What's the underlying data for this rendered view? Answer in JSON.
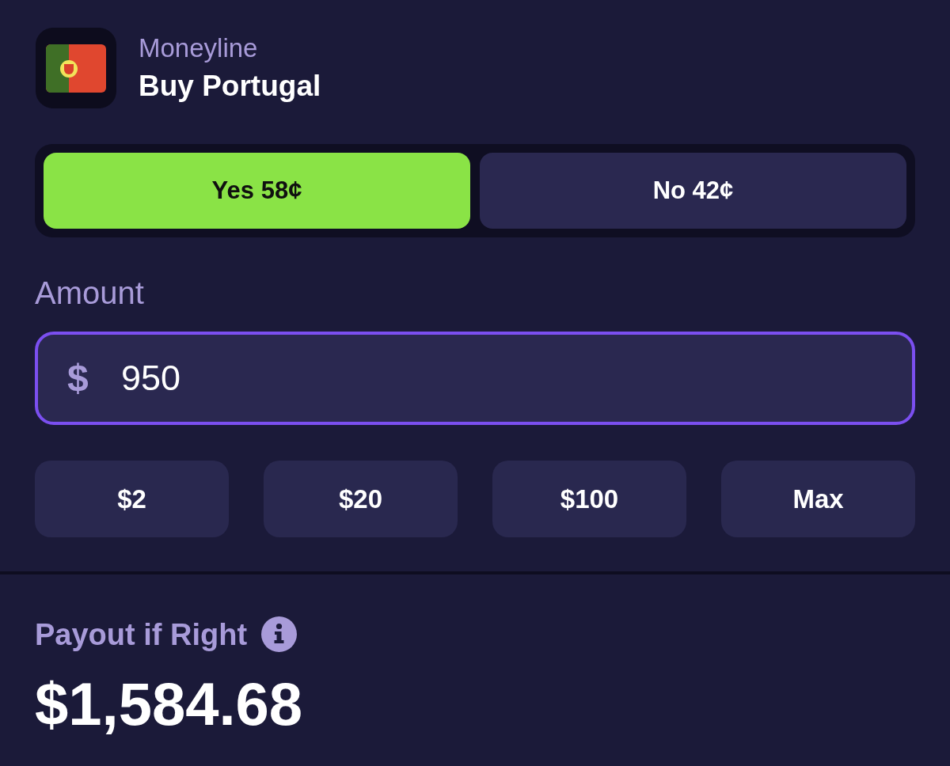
{
  "market": {
    "type_label": "Moneyline",
    "title": "Buy Portugal"
  },
  "outcomes": [
    {
      "label": "Yes 58¢",
      "selected": true
    },
    {
      "label": "No 42¢",
      "selected": false
    }
  ],
  "amount": {
    "label": "Amount",
    "currency_symbol": "$",
    "value": "950",
    "focused": true
  },
  "quick_amounts": [
    "$2",
    "$20",
    "$100",
    "Max"
  ],
  "payout": {
    "label": "Payout if Right",
    "value": "$1,584.68"
  }
}
